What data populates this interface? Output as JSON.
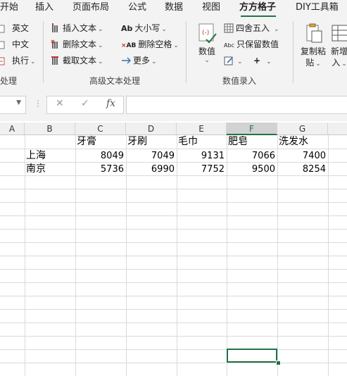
{
  "tabs": {
    "start": "开始",
    "insert": "插入",
    "layout": "页面布局",
    "formula": "公式",
    "data": "数据",
    "view": "视图",
    "fangfang": "方方格子",
    "diy": "DIY工具箱"
  },
  "ribbon": {
    "left_group": {
      "english": "英文",
      "chinese": "中文",
      "execute": "执行",
      "label": "处理"
    },
    "advanced_text": {
      "insert_text": "插入文本",
      "delete_text": "删除文本",
      "extract_text": "截取文本",
      "case": "大小写",
      "delete_space": "删除空格",
      "more": "更多",
      "case_icon_text": "Ab",
      "space_icon_text": "AB",
      "label": "高级文本处理"
    },
    "data_entry": {
      "value_button": "数值",
      "round": "四舍五入",
      "keep_values": "只保留数值",
      "abc_icon_text": "Abc",
      "plus_icon_text": "+",
      "label": "数值录入"
    },
    "paste_group": {
      "copy_paste_line1": "复制粘",
      "copy_paste_line2": "贴",
      "new_insert_line1": "新增",
      "new_insert_line2": "入"
    }
  },
  "formula_bar": {
    "cancel_glyph": "✕",
    "confirm_glyph": "✓",
    "fx_glyph": "fx",
    "dots": "⋮",
    "value": ""
  },
  "sheet": {
    "columns": [
      "A",
      "B",
      "C",
      "D",
      "E",
      "F",
      "G"
    ],
    "selected_column": "F",
    "header_row": [
      "",
      "",
      "牙膏",
      "牙刷",
      "毛巾",
      "肥皂",
      "洗发水"
    ],
    "rows": [
      {
        "city": "上海",
        "values": [
          "8049",
          "7049",
          "9131",
          "7066",
          "7400"
        ]
      },
      {
        "city": "南京",
        "values": [
          "5736",
          "6990",
          "7752",
          "9500",
          "8254"
        ]
      }
    ]
  },
  "colors": {
    "accent": "#217346",
    "ribbon_bg": "#f3f3f3",
    "gridline": "#dadada"
  }
}
